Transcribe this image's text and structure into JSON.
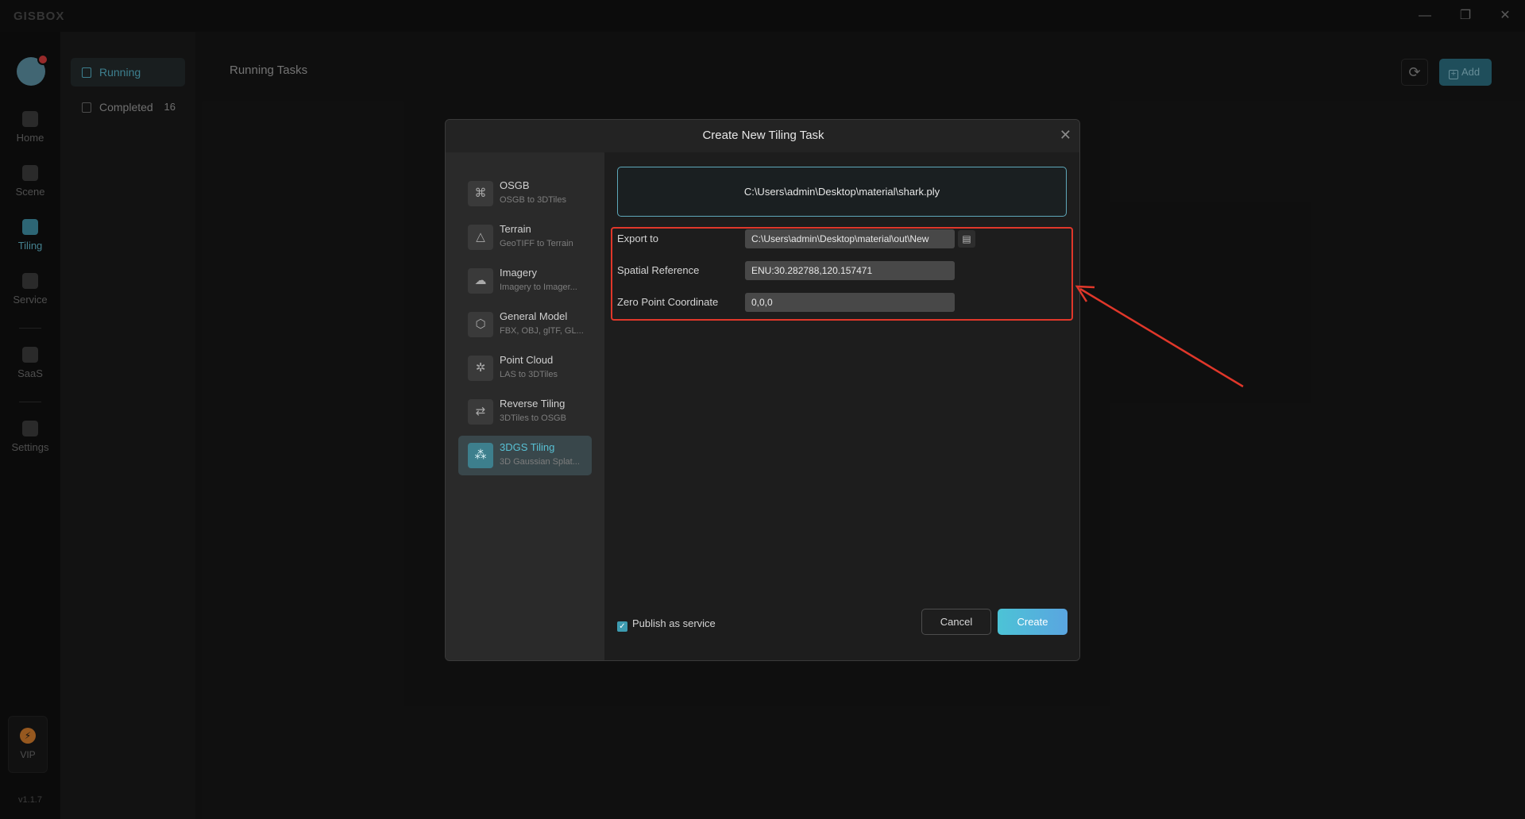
{
  "app": {
    "logo": "GISBOX",
    "version": "v1.1.7"
  },
  "window_controls": {
    "minimize": "—",
    "restore": "❐",
    "close": "✕"
  },
  "nav": {
    "items": [
      {
        "label": "Home",
        "icon": "home-icon"
      },
      {
        "label": "Scene",
        "icon": "cube-icon"
      },
      {
        "label": "Tiling",
        "icon": "tiling-icon"
      },
      {
        "label": "Service",
        "icon": "service-icon"
      },
      {
        "label": "SaaS",
        "icon": "lock-icon"
      },
      {
        "label": "Settings",
        "icon": "gear-icon"
      }
    ],
    "vip_label": "VIP",
    "vip_icon": "⚡"
  },
  "subnav": {
    "items": [
      {
        "label": "Running",
        "count": ""
      },
      {
        "label": "Completed",
        "count": "16"
      }
    ]
  },
  "main": {
    "title": "Running Tasks",
    "refresh_icon": "⟳",
    "add_label": "Add"
  },
  "dialog": {
    "title": "Create New Tiling Task",
    "close_icon": "✕",
    "types": [
      {
        "name": "OSGB",
        "desc": "OSGB to 3DTiles",
        "icon": "⌘"
      },
      {
        "name": "Terrain",
        "desc": "GeoTIFF to Terrain",
        "icon": "△"
      },
      {
        "name": "Imagery",
        "desc": "Imagery to Imager...",
        "icon": "☁"
      },
      {
        "name": "General Model",
        "desc": "FBX, OBJ, glTF, GL...",
        "icon": "⬡"
      },
      {
        "name": "Point Cloud",
        "desc": "LAS to 3DTiles",
        "icon": "✲"
      },
      {
        "name": "Reverse Tiling",
        "desc": "3DTiles to OSGB",
        "icon": "⇄"
      },
      {
        "name": "3DGS Tiling",
        "desc": "3D Gaussian Splat...",
        "icon": "⁂"
      }
    ],
    "input_file": "C:\\Users\\admin\\Desktop\\material\\shark.ply",
    "form": {
      "export_label": "Export to",
      "export_value": "C:\\Users\\admin\\Desktop\\material\\out\\New",
      "spatial_label": "Spatial Reference",
      "spatial_value": "ENU:30.282788,120.157471",
      "zero_label": "Zero Point Coordinate",
      "zero_value": "0,0,0"
    },
    "publish_label": "Publish as service",
    "publish_checked": true,
    "cancel_label": "Cancel",
    "create_label": "Create"
  },
  "colors": {
    "accent": "#4cc3d6",
    "annotation": "#e0372a",
    "background": "#161616"
  }
}
